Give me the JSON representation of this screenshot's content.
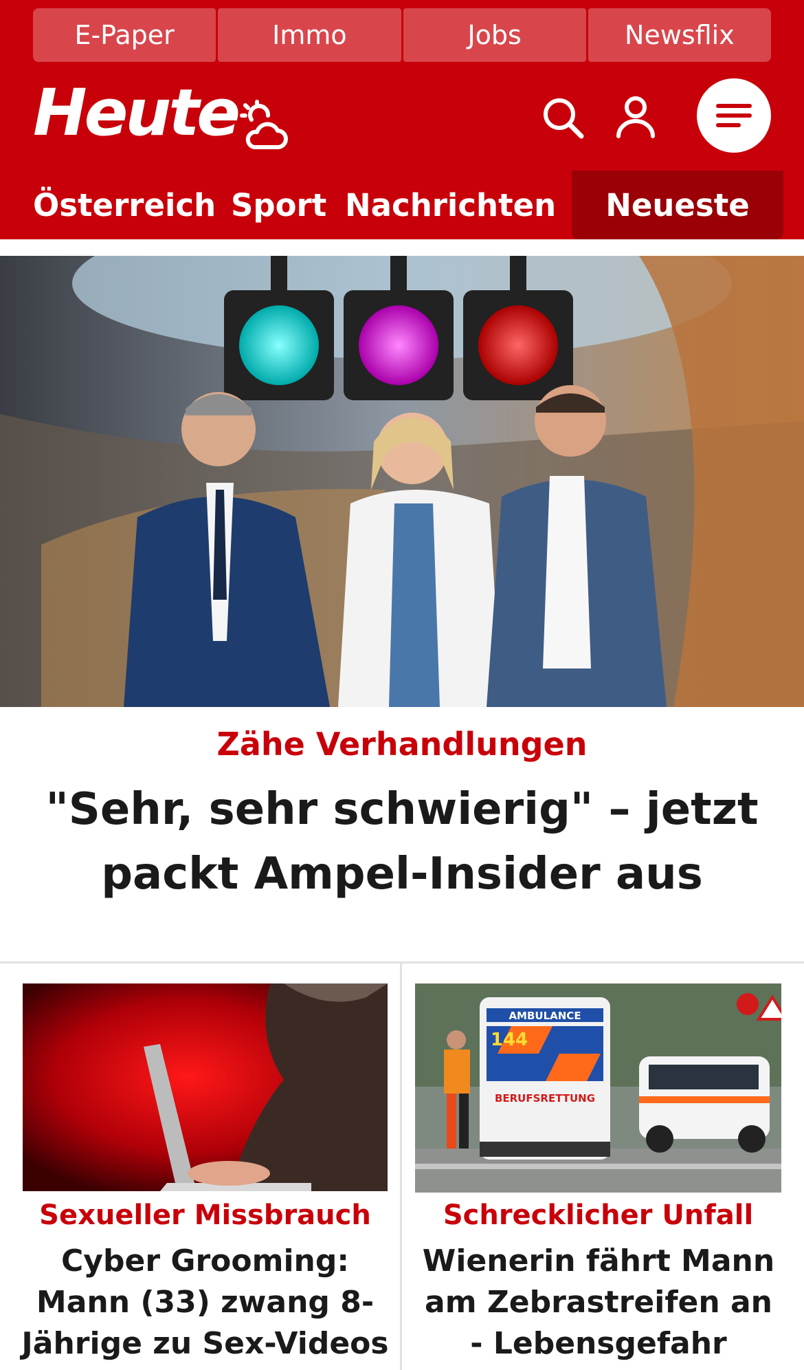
{
  "top_links": [
    "E-Paper",
    "Immo",
    "Jobs",
    "Newsflix"
  ],
  "brand": {
    "logo_text": "Heute"
  },
  "header_icons": [
    "weather-icon",
    "search-icon",
    "user-icon",
    "menu-icon"
  ],
  "nav": {
    "items": [
      "Österreich",
      "Sport",
      "Nachrichten"
    ],
    "active": "Neueste"
  },
  "hero": {
    "kicker": "Zähe Verhandlungen",
    "title": "\"Sehr, sehr schwierig\" – jetzt packt Ampel-Insider aus"
  },
  "articles": [
    {
      "kicker": "Sexueller Missbrauch",
      "title": "Cyber Grooming: Mann (33) zwang 8-Jährige zu Sex-Videos"
    },
    {
      "kicker": "Schrecklicher Unfall",
      "title": "Wienerin fährt Mann am Zebrastreifen an - Lebensgefahr",
      "image_text": {
        "vehicle_label": "AMBULANCE",
        "vehicle_number": "144",
        "service": "BERUFSRETTUNG"
      }
    }
  ],
  "colors": {
    "brand_red": "#c8000a",
    "nav_active": "#9a0006",
    "top_link_bg": "#d8464c",
    "text": "#1a1a1a"
  }
}
